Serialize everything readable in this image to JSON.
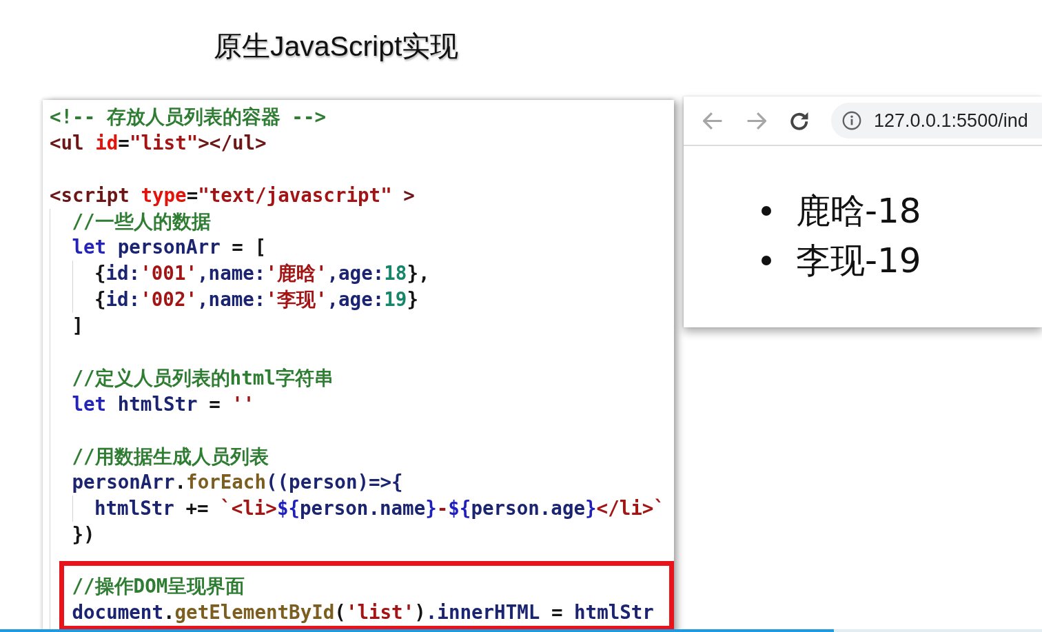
{
  "slide_title": "原生JavaScript实现",
  "code_editor": {
    "groups": [
      {
        "highlighted": false,
        "lines": [
          {
            "tokens": [
              {
                "kind": "comment",
                "text": "<!-- 存放人员列表的容器 -->"
              }
            ]
          },
          {
            "tokens": [
              {
                "kind": "tag",
                "text": "<ul "
              },
              {
                "kind": "attr",
                "text": "id"
              },
              {
                "kind": "punct",
                "text": "="
              },
              {
                "kind": "string",
                "text": "\"list\""
              },
              {
                "kind": "tag",
                "text": "></ul>"
              }
            ]
          }
        ]
      },
      {
        "highlighted": false,
        "lines": [
          {
            "tokens": [
              {
                "kind": "tag",
                "text": "<script "
              },
              {
                "kind": "attr",
                "text": "type"
              },
              {
                "kind": "punct",
                "text": "="
              },
              {
                "kind": "string",
                "text": "\"text/javascript\""
              },
              {
                "kind": "tag",
                "text": " >"
              }
            ],
            "children": [
              {
                "highlighted": false,
                "lines": [
                  {
                    "tokens": [
                      {
                        "kind": "comment",
                        "text": "//一些人的数据"
                      }
                    ]
                  },
                  {
                    "tokens": [
                      {
                        "kind": "keyword",
                        "text": "let "
                      },
                      {
                        "kind": "ident",
                        "text": "personArr"
                      },
                      {
                        "kind": "punct",
                        "text": " = ["
                      }
                    ],
                    "children": [
                      {
                        "highlighted": false,
                        "lines": [
                          {
                            "tokens": [
                              {
                                "kind": "punct",
                                "text": "{"
                              },
                              {
                                "kind": "ident",
                                "text": "id:"
                              },
                              {
                                "kind": "string",
                                "text": "'001'"
                              },
                              {
                                "kind": "ident",
                                "text": ",name:"
                              },
                              {
                                "kind": "string",
                                "text": "'鹿晗'"
                              },
                              {
                                "kind": "ident",
                                "text": ",age:"
                              },
                              {
                                "kind": "number",
                                "text": "18"
                              },
                              {
                                "kind": "punct",
                                "text": "},"
                              }
                            ]
                          },
                          {
                            "tokens": [
                              {
                                "kind": "punct",
                                "text": "{"
                              },
                              {
                                "kind": "ident",
                                "text": "id:"
                              },
                              {
                                "kind": "string",
                                "text": "'002'"
                              },
                              {
                                "kind": "ident",
                                "text": ",name:"
                              },
                              {
                                "kind": "string",
                                "text": "'李现'"
                              },
                              {
                                "kind": "ident",
                                "text": ",age:"
                              },
                              {
                                "kind": "number",
                                "text": "19"
                              },
                              {
                                "kind": "punct",
                                "text": "}"
                              }
                            ]
                          }
                        ]
                      }
                    ]
                  },
                  {
                    "tokens": [
                      {
                        "kind": "punct",
                        "text": "]"
                      }
                    ]
                  }
                ]
              },
              {
                "highlighted": false,
                "lines": [
                  {
                    "tokens": [
                      {
                        "kind": "comment",
                        "text": "//定义人员列表的html字符串"
                      }
                    ]
                  },
                  {
                    "tokens": [
                      {
                        "kind": "keyword",
                        "text": "let "
                      },
                      {
                        "kind": "ident",
                        "text": "htmlStr"
                      },
                      {
                        "kind": "punct",
                        "text": " = "
                      },
                      {
                        "kind": "string",
                        "text": "''"
                      }
                    ]
                  }
                ]
              },
              {
                "highlighted": false,
                "lines": [
                  {
                    "tokens": [
                      {
                        "kind": "comment",
                        "text": "//用数据生成人员列表"
                      }
                    ]
                  },
                  {
                    "tokens": [
                      {
                        "kind": "ident",
                        "text": "personArr"
                      },
                      {
                        "kind": "punct",
                        "text": "."
                      },
                      {
                        "kind": "method",
                        "text": "forEach"
                      },
                      {
                        "kind": "ident",
                        "text": "((person)=>{"
                      }
                    ],
                    "children": [
                      {
                        "highlighted": false,
                        "lines": [
                          {
                            "tokens": [
                              {
                                "kind": "ident",
                                "text": "htmlStr"
                              },
                              {
                                "kind": "punct",
                                "text": " += "
                              },
                              {
                                "kind": "template",
                                "text": "`<li>"
                              },
                              {
                                "kind": "interp",
                                "text": "${"
                              },
                              {
                                "kind": "ident",
                                "text": "person.name"
                              },
                              {
                                "kind": "interp",
                                "text": "}"
                              },
                              {
                                "kind": "template",
                                "text": "-"
                              },
                              {
                                "kind": "interp",
                                "text": "${"
                              },
                              {
                                "kind": "ident",
                                "text": "person.age"
                              },
                              {
                                "kind": "interp",
                                "text": "}"
                              },
                              {
                                "kind": "template",
                                "text": "</li>`"
                              }
                            ]
                          }
                        ]
                      }
                    ]
                  },
                  {
                    "tokens": [
                      {
                        "kind": "punct",
                        "text": "})"
                      }
                    ]
                  }
                ]
              },
              {
                "highlighted": true,
                "lines": [
                  {
                    "tokens": [
                      {
                        "kind": "comment",
                        "text": "//操作DOM呈现界面"
                      }
                    ]
                  },
                  {
                    "tokens": [
                      {
                        "kind": "ident",
                        "text": "document"
                      },
                      {
                        "kind": "punct",
                        "text": "."
                      },
                      {
                        "kind": "method",
                        "text": "getElementById"
                      },
                      {
                        "kind": "punct",
                        "text": "("
                      },
                      {
                        "kind": "string",
                        "text": "'list'"
                      },
                      {
                        "kind": "punct",
                        "text": ")"
                      },
                      {
                        "kind": "ident",
                        "text": ".innerHTML"
                      },
                      {
                        "kind": "punct",
                        "text": " = "
                      },
                      {
                        "kind": "ident",
                        "text": "htmlStr"
                      }
                    ]
                  }
                ]
              }
            ]
          }
        ]
      }
    ]
  },
  "browser": {
    "nav_buttons": [
      {
        "kind": "back",
        "disabled": true
      },
      {
        "kind": "forward",
        "disabled": true
      },
      {
        "kind": "reload",
        "disabled": false
      }
    ],
    "address": "127.0.0.1:5500/ind",
    "list_items": [
      "鹿晗-18",
      "李现-19"
    ]
  },
  "video_player": {
    "progress": {
      "level": 0.8
    }
  }
}
